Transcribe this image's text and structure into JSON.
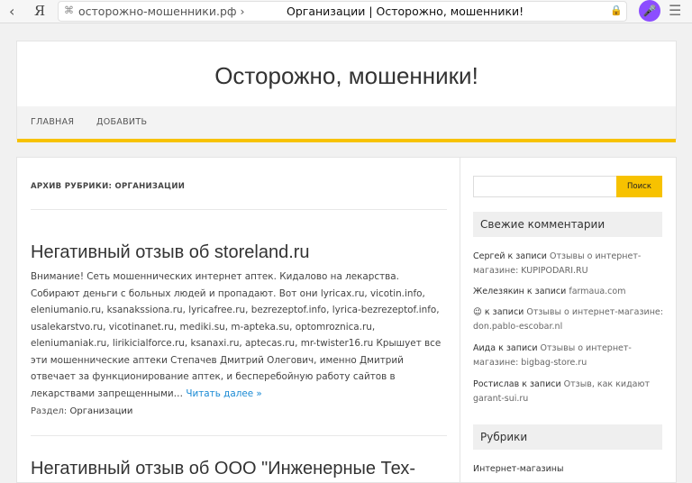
{
  "browser": {
    "back": "‹",
    "ya": "Я",
    "domain": "осторожно-мошенники.рф ›",
    "page_title": "Организации | Осторожно, мошенники!"
  },
  "site": {
    "title": "Осторожно, мошенники!",
    "menu": [
      "ГЛАВНАЯ",
      "ДОБАВИТЬ"
    ]
  },
  "main": {
    "archive_title": "АРХИВ РУБРИКИ: ОРГАНИЗАЦИИ",
    "posts": [
      {
        "title": "Негативный отзыв об storeland.ru",
        "excerpt": "Внимание! Сеть мошеннических интернет аптек. Кидалово на лекарства. Собирают деньги с больных людей и пропадают. Вот они lyricax.ru, vicotin.info, eleniumanio.ru, ksanakssiona.ru, lyricafree.ru, bezrezeptof.info, lyrica-bezrezeptof.info, usalekarstvo.ru, vicotinanet.ru, mediki.su, m-apteka.su, optomroznica.ru, eleniumaniak.ru, lirikicialforce.ru, ksanaxi.ru, aptecas.ru, mr-twister16.ru Крышует все эти мошеннические аптеки Степачев Дмитрий Олегович, именно Дмитрий отвечает за функционирование аптек, и бесперебойную работу сайтов в лекарствами запрещенными…",
        "more": "Читать далее »",
        "category_label": "Раздел:",
        "category": "Организации"
      },
      {
        "title": "Негативный отзыв об ООО \"Инженерные Тех-"
      }
    ]
  },
  "sidebar": {
    "search_button": "Поиск",
    "recent_comments_title": "Свежие комментарии",
    "comments": [
      {
        "author": "Сергей",
        "sep": " к записи ",
        "post": "Отзывы о интернет-магазине: KUPIPODARI.RU"
      },
      {
        "author": "Железякин",
        "sep": " к записи ",
        "post": "farmaua.com"
      },
      {
        "author": "😉",
        "sep": " к записи ",
        "post": "Отзывы о интернет-магазине: don.pablo-escobar.nl"
      },
      {
        "author": "Аида",
        "sep": " к записи ",
        "post": "Отзывы о интернет-магазине: bigbag-store.ru"
      },
      {
        "author": "Ростислав",
        "sep": " к записи ",
        "post": "Отзыв, как кидают garant-sui.ru"
      }
    ],
    "rubrics_title": "Рубрики",
    "rubrics": [
      "Интернет-магазины"
    ]
  }
}
